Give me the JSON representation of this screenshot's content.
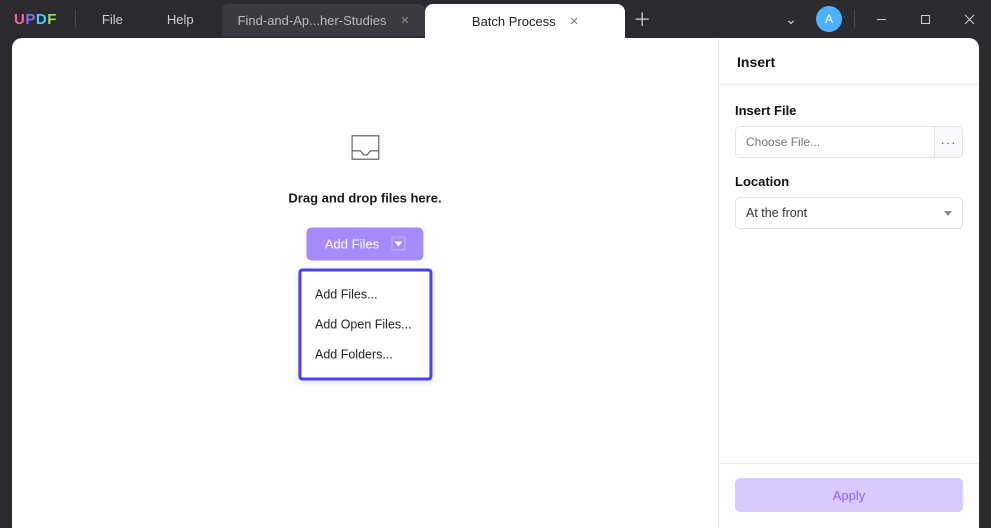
{
  "brand": {
    "U": "U",
    "P": "P",
    "D": "D",
    "F": "F"
  },
  "menu": {
    "file": "File",
    "help": "Help"
  },
  "tabs": {
    "inactive": {
      "label": "Find-and-Ap...her-Studies"
    },
    "active": {
      "label": "Batch Process"
    }
  },
  "avatar_initial": "A",
  "dropzone": {
    "text": "Drag and drop files here.",
    "button": "Add Files",
    "menu": {
      "add_files": "Add Files...",
      "add_open": "Add Open Files...",
      "add_folders": "Add Folders..."
    }
  },
  "panel": {
    "title": "Insert",
    "insert_file_label": "Insert File",
    "choose_placeholder": "Choose File...",
    "location_label": "Location",
    "location_value": "At the front",
    "apply": "Apply"
  }
}
